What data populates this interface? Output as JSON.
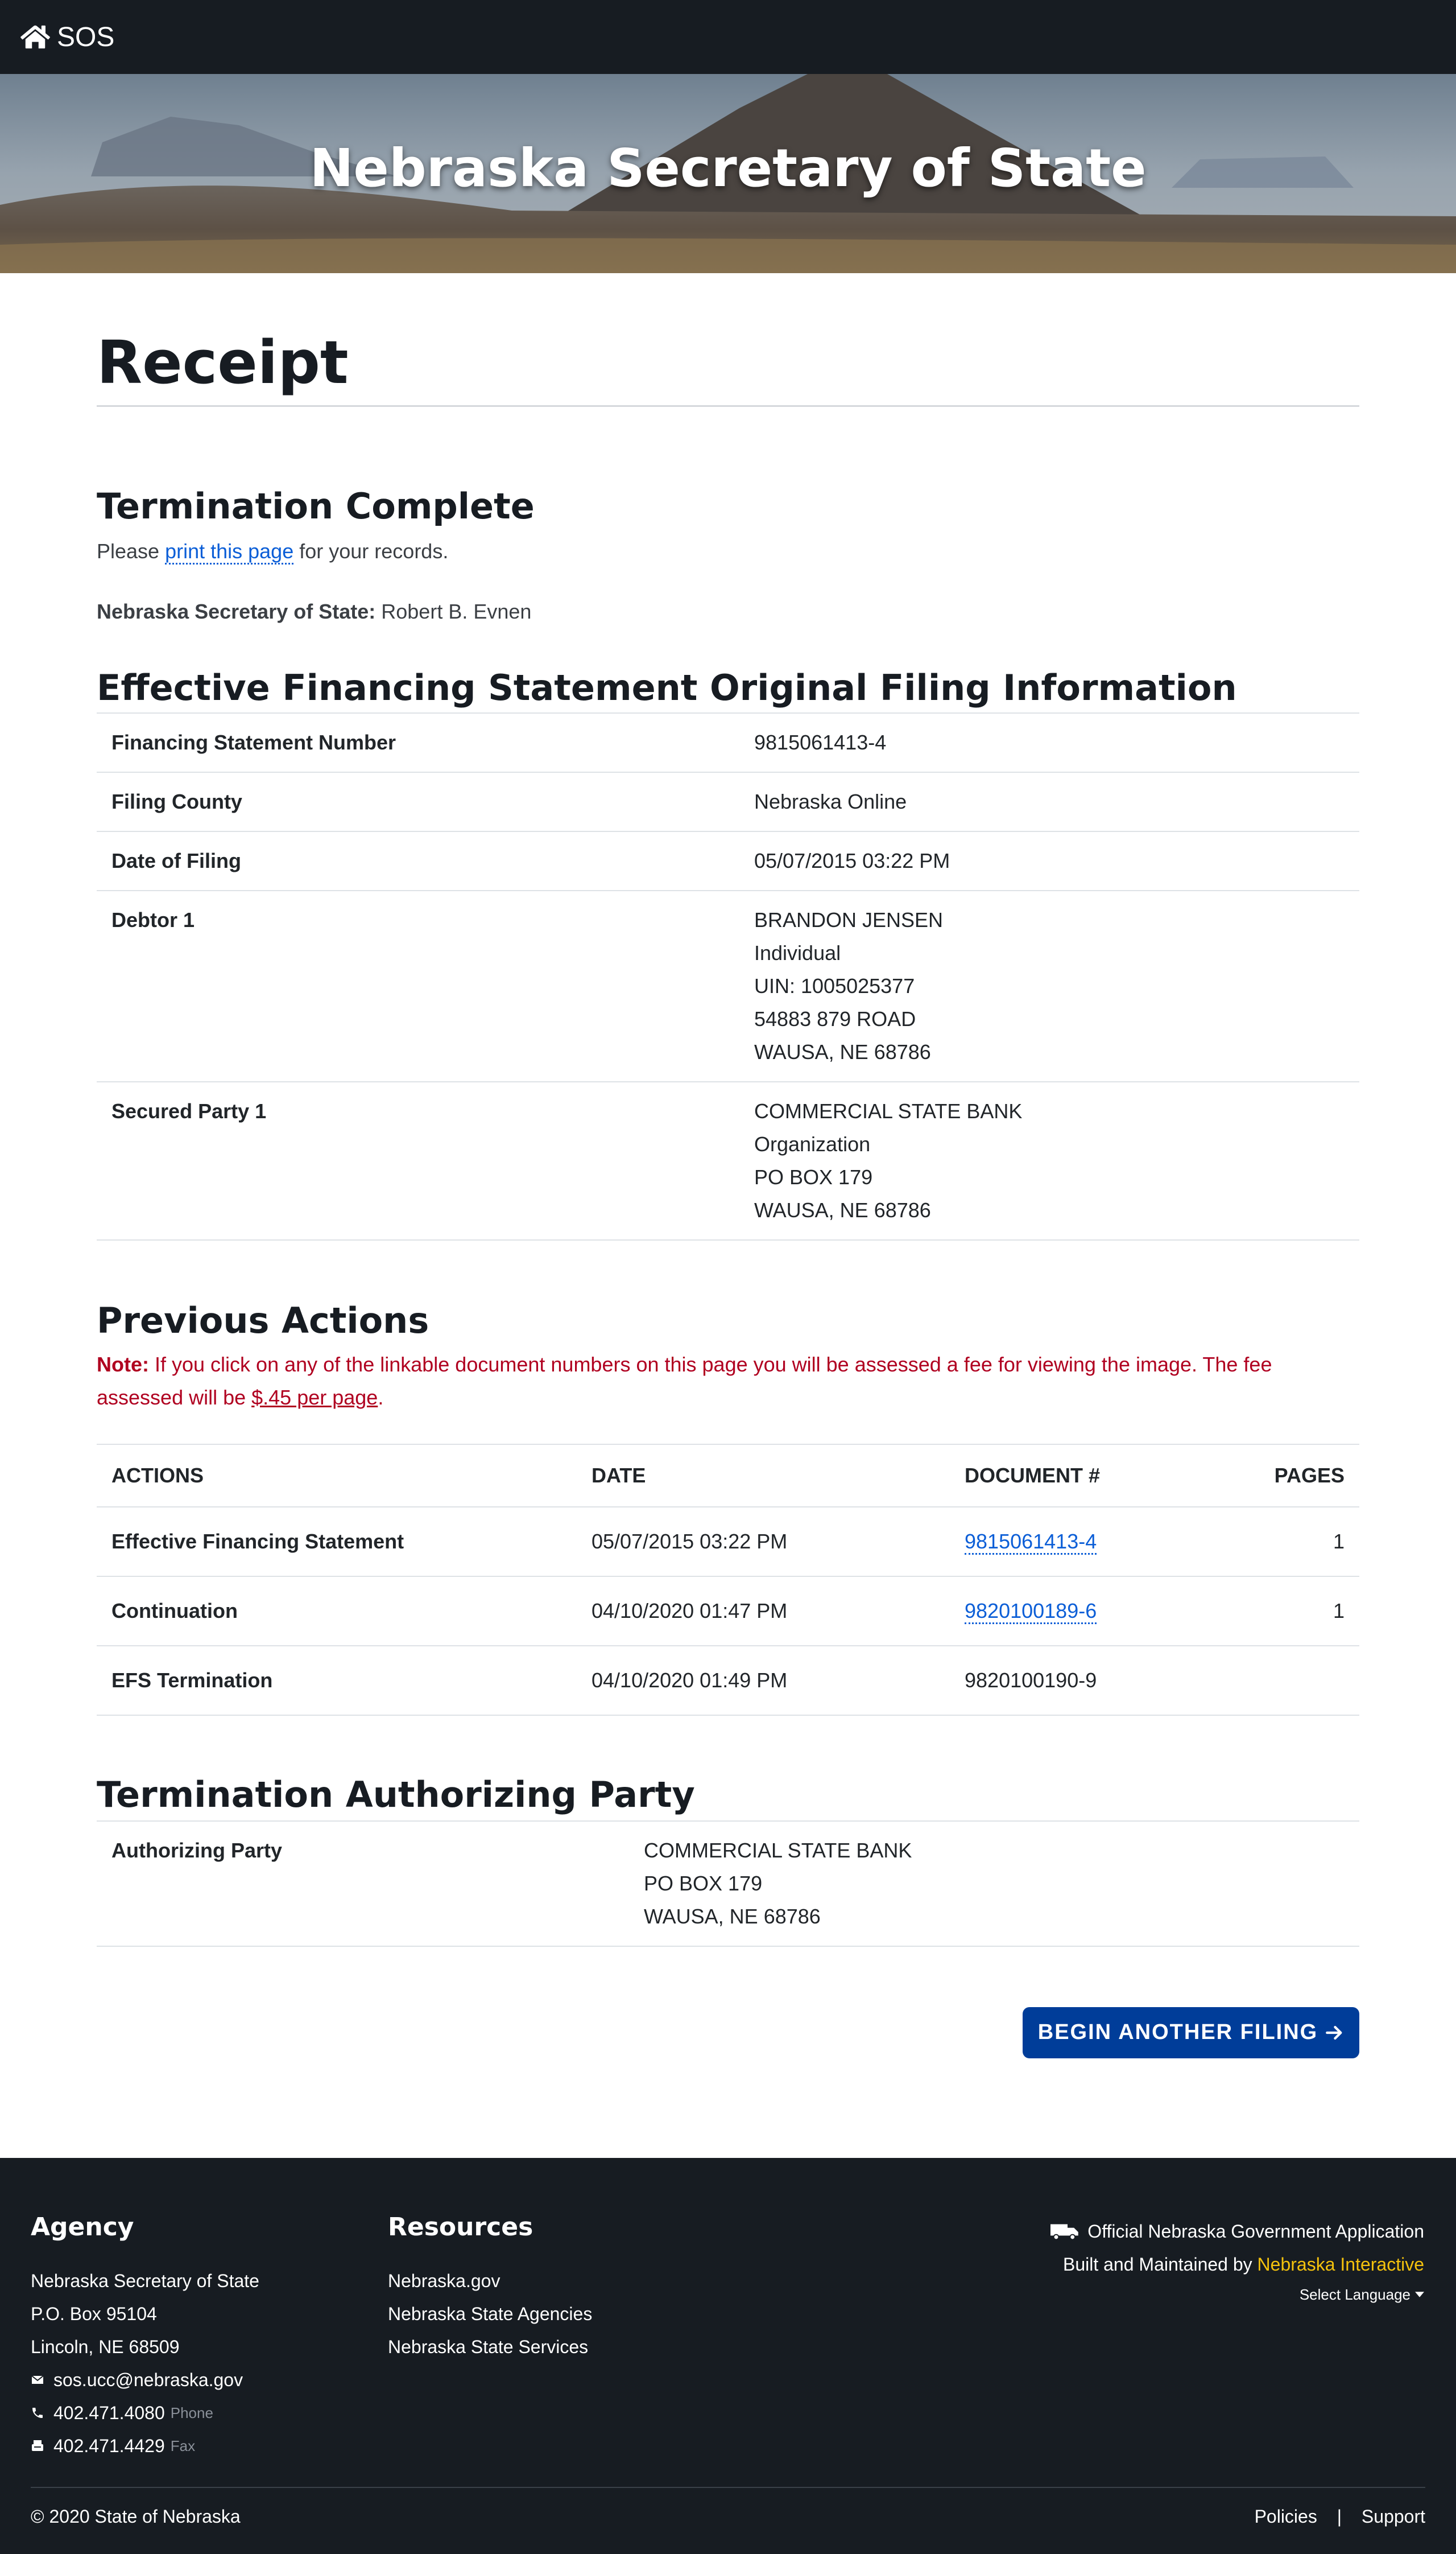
{
  "nav": {
    "home_label": "SOS"
  },
  "banner": {
    "title": "Nebraska Secretary of State"
  },
  "page": {
    "title": "Receipt"
  },
  "termination": {
    "heading": "Termination Complete",
    "print_prefix": "Please ",
    "print_link": "print this page",
    "print_suffix": " for your records.",
    "sos_label": "Nebraska Secretary of State:",
    "sos_name": "Robert B. Evnen"
  },
  "efs": {
    "heading": "Effective Financing Statement Original Filing Information",
    "rows": [
      {
        "label": "Financing Statement Number",
        "value": [
          "9815061413-4"
        ]
      },
      {
        "label": "Filing County",
        "value": [
          "Nebraska Online"
        ]
      },
      {
        "label": "Date of Filing",
        "value": [
          "05/07/2015 03:22 PM"
        ]
      },
      {
        "label": "Debtor 1",
        "value": [
          "BRANDON JENSEN",
          "Individual",
          "UIN: 1005025377",
          "54883 879 ROAD",
          "WAUSA,  NE  68786"
        ]
      },
      {
        "label": "Secured Party 1",
        "value": [
          "COMMERCIAL STATE BANK",
          "Organization",
          "PO BOX 179",
          "WAUSA,  NE  68786"
        ]
      }
    ]
  },
  "previous": {
    "heading": "Previous Actions",
    "note_label": "Note:",
    "note_text": " If you click on any of the linkable document numbers on this page you will be assessed a fee for viewing the image. The fee assessed will be ",
    "note_fee": "$.45 per page",
    "note_end": ".",
    "columns": [
      "ACTIONS",
      "DATE",
      "DOCUMENT #",
      "PAGES"
    ],
    "rows": [
      {
        "action": "Effective Financing Statement",
        "date": "05/07/2015 03:22 PM",
        "doc": "9815061413-4",
        "doc_link": true,
        "pages": "1"
      },
      {
        "action": "Continuation",
        "date": "04/10/2020 01:47 PM",
        "doc": "9820100189-6",
        "doc_link": true,
        "pages": "1"
      },
      {
        "action": "EFS Termination",
        "date": "04/10/2020 01:49 PM",
        "doc": "9820100190-9",
        "doc_link": false,
        "pages": ""
      }
    ]
  },
  "authorizing": {
    "heading": "Termination Authorizing Party",
    "label": "Authorizing Party",
    "value": [
      "COMMERCIAL STATE BANK",
      "PO BOX 179",
      "WAUSA,  NE  68786"
    ]
  },
  "actions": {
    "begin_label": "BEGIN ANOTHER FILING"
  },
  "footer": {
    "agency": {
      "heading": "Agency",
      "name": "Nebraska Secretary of State",
      "po_box": "P.O. Box 95104",
      "city": "Lincoln, NE 68509",
      "email": "sos.ucc@nebraska.gov",
      "phone": "402.471.4080",
      "phone_label": "Phone",
      "fax": "402.471.4429",
      "fax_label": "Fax"
    },
    "resources": {
      "heading": "Resources",
      "links": [
        "Nebraska.gov",
        "Nebraska State Agencies",
        "Nebraska State Services"
      ]
    },
    "official": "Official Nebraska Government Application",
    "built_prefix": "Built and Maintained by ",
    "built_by": "Nebraska Interactive",
    "language": "Select Language",
    "copyright": "© 2020 State of Nebraska",
    "policies": "Policies",
    "separator": "|",
    "support": "Support"
  },
  "colors": {
    "nav_bg": "#171c22",
    "button_bg": "#003d99",
    "link": "#0b5ed7",
    "note": "#b00020",
    "accent_yellow": "#f4c20d"
  }
}
